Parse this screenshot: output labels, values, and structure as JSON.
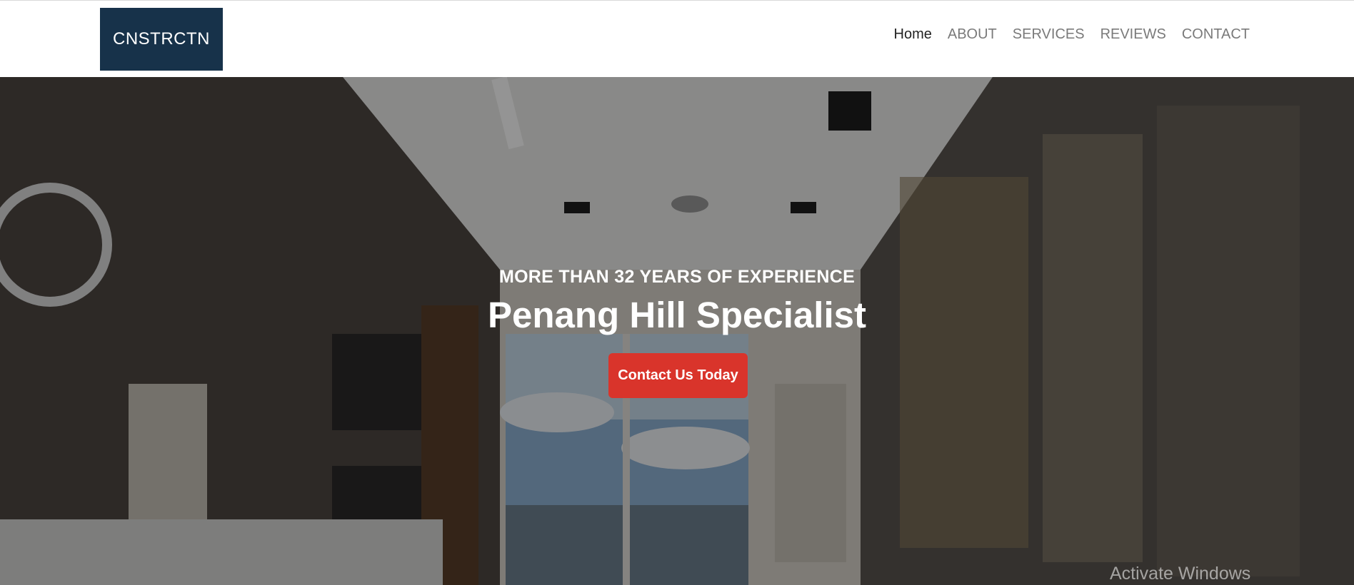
{
  "navbar": {
    "logo_text": "CNSTRCTN",
    "links": [
      {
        "label": "Home"
      },
      {
        "label": "ABOUT"
      },
      {
        "label": "SERVICES"
      },
      {
        "label": "REVIEWS"
      },
      {
        "label": "CONTACT"
      }
    ]
  },
  "hero": {
    "subtitle": "MORE THAN 32 YEARS OF EXPERIENCE",
    "title": "Penang Hill Specialist",
    "cta_label": "Contact Us Today"
  },
  "system": {
    "watermark": "Activate Windows"
  },
  "colors": {
    "logo_bg": "#17324a",
    "cta_bg": "#d9342b",
    "nav_active": "#222222",
    "nav_inactive": "#7a7a7a"
  }
}
